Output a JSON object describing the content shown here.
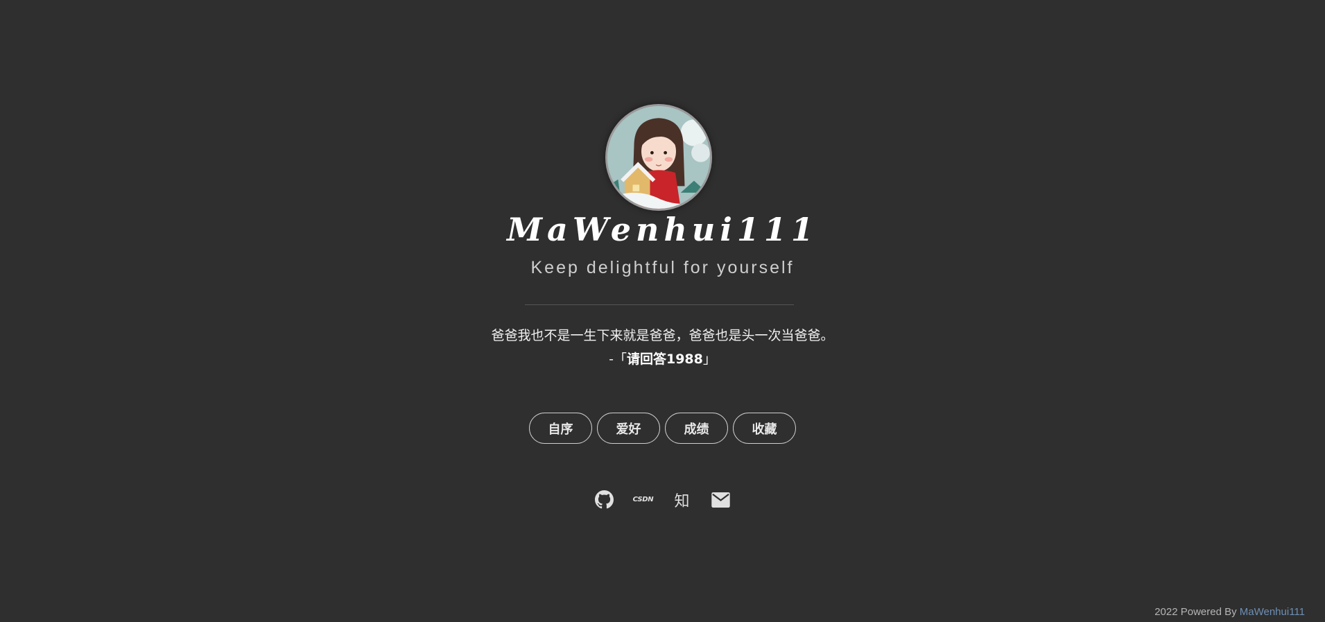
{
  "profile": {
    "name": "MaWenhui111",
    "motto": "Keep delightful for yourself"
  },
  "quote": {
    "text": "爸爸我也不是一生下来就是爸爸，爸爸也是头一次当爸爸。",
    "source_prefix": "-「",
    "source": "请回答1988",
    "source_suffix": "」"
  },
  "nav": {
    "items": [
      {
        "label": "自序"
      },
      {
        "label": "爱好"
      },
      {
        "label": "成绩"
      },
      {
        "label": "收藏"
      }
    ]
  },
  "social": {
    "icons": [
      "github-icon",
      "csdn-icon",
      "zhihu-icon",
      "mail-icon"
    ],
    "csdn_label": "CSDN",
    "zhihu_label": "知"
  },
  "footer": {
    "prefix": "2022 Powered By ",
    "link": "MaWenhui111"
  },
  "colors": {
    "background": "#2f2f2f",
    "footer_link": "#6d8fb5"
  }
}
